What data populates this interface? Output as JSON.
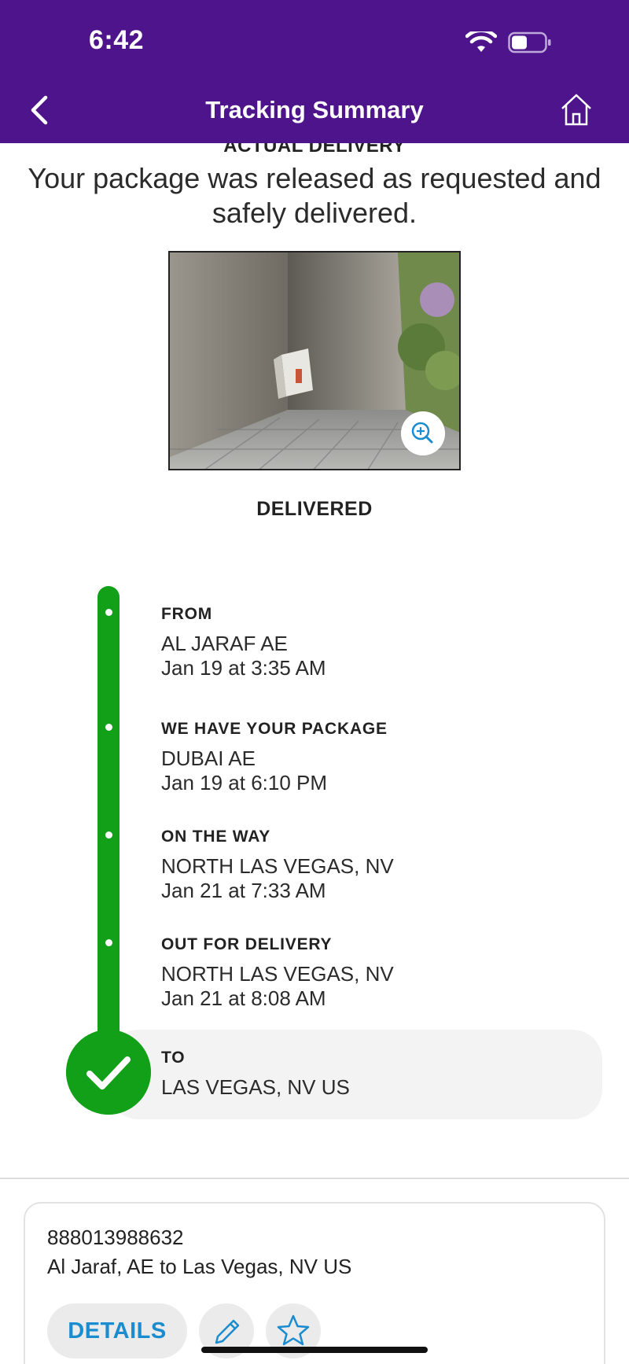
{
  "status_bar": {
    "time": "6:42"
  },
  "header": {
    "title": "Tracking Summary"
  },
  "delivery": {
    "heading": "ACTUAL DELIVERY",
    "message": "Your package was released as requested and safely delivered.",
    "status": "DELIVERED"
  },
  "timeline": [
    {
      "label": "FROM",
      "location": "AL JARAF AE",
      "time": "Jan 19 at 3:35 AM"
    },
    {
      "label": "WE HAVE YOUR PACKAGE",
      "location": "DUBAI AE",
      "time": "Jan 19 at 6:10 PM"
    },
    {
      "label": "ON THE WAY",
      "location": "NORTH LAS VEGAS, NV",
      "time": "Jan 21 at 7:33 AM"
    },
    {
      "label": "OUT FOR DELIVERY",
      "location": "NORTH LAS VEGAS, NV",
      "time": "Jan 21 at 8:08 AM"
    },
    {
      "label": "TO",
      "location": "LAS VEGAS, NV  US"
    }
  ],
  "shipment": {
    "tracking_number": "888013988632",
    "route": "Al Jaraf, AE to Las Vegas, NV US",
    "details_label": "DETAILS"
  },
  "colors": {
    "header_purple": "#4d148c",
    "progress_green": "#12a019",
    "link_blue": "#1a8ccf"
  },
  "icons": [
    "back-chevron-icon",
    "home-icon",
    "wifi-icon",
    "battery-icon",
    "zoom-in-icon",
    "checkmark-icon",
    "pencil-icon",
    "star-icon"
  ]
}
